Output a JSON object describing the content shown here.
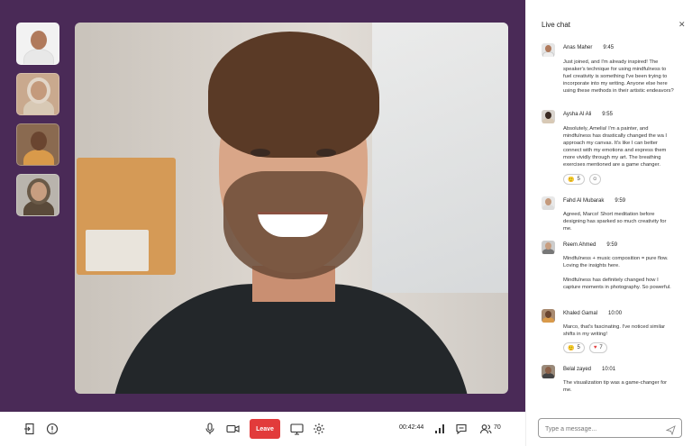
{
  "call": {
    "leave_label": "Leave",
    "timer": "00:42:44",
    "participant_count": "70"
  },
  "chat": {
    "title": "Live chat",
    "input_placeholder": "Type a message...",
    "messages": [
      {
        "name": "Anas Maher",
        "time": "9:45",
        "text": "Just joined, and I'm already inspired! The speaker's technique for using mindfulness to fuel creativity is something I've been trying to incorporate into my writing. Anyone else here using these methods in their artistic endeavors?"
      },
      {
        "name": "Aysha Al Ali",
        "time": "9:55",
        "text": "Absolutely, Amelia! I'm a painter, and mindfulness has drastically changed the wa I approach my canvas. It's like I can better connect with my emotions and express them more vividly through my art. The breathing exercises mentioned are a game changer.",
        "reaction": "5"
      },
      {
        "name": "Fahd Al Mubarak",
        "time": "9:59",
        "text": "Agreed, Marco! Short meditation before designing has sparked so much creativity for me."
      },
      {
        "name": "Reem Ahmed",
        "time": "9:59",
        "text": "Mindfulness + music composition = pure flow. Loving the insights here.",
        "text2": "Mindfulness has definitely changed how I capture moments in photography. So powerful."
      },
      {
        "name": "Khaled Gamal",
        "time": "10:00",
        "text": "Marco, that's fascinating. I've noticed similar shifts in my writing!",
        "reaction_smile": "5",
        "reaction_heart": "7"
      },
      {
        "name": "Belal zayed",
        "time": "10:01",
        "text": "The visualization tip was a game-changer for me."
      }
    ]
  },
  "colors": {
    "stage": "#4a2a57",
    "leave": "#e23b3b"
  }
}
